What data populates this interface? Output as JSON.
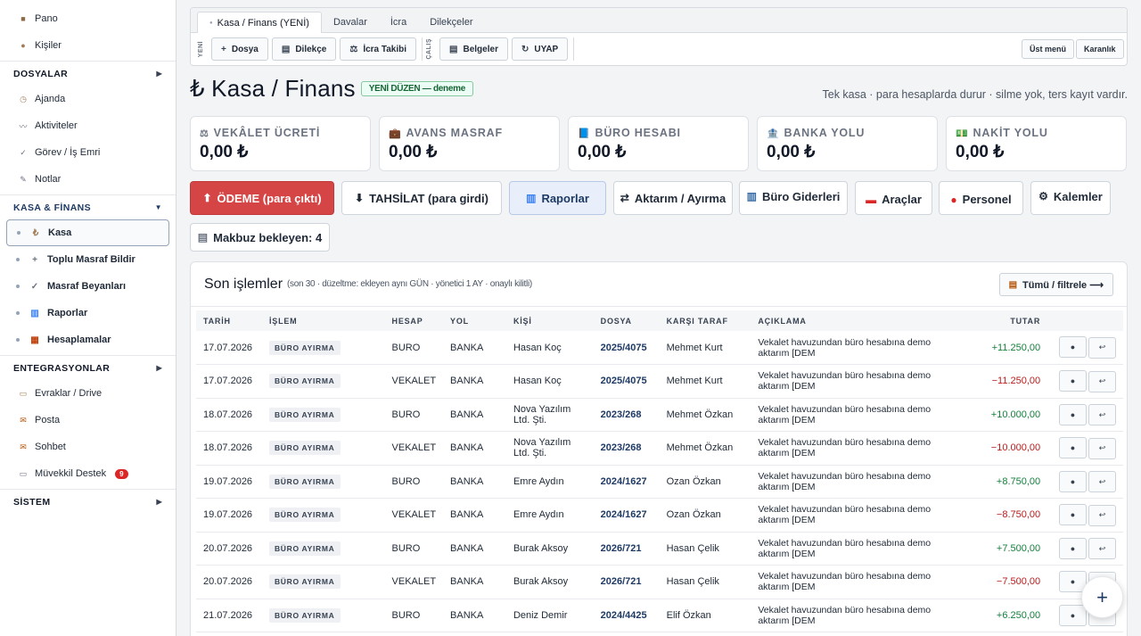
{
  "sidebar": {
    "top_items": [
      {
        "label": "Pano",
        "icon": "square-icon"
      },
      {
        "label": "Kişiler",
        "icon": "circle-icon"
      }
    ],
    "sec_dosyalar": "DOSYALAR",
    "dos_items": [
      {
        "label": "Ajanda",
        "icon": "clock-icon"
      },
      {
        "label": "Aktiviteler",
        "icon": "activity-icon"
      },
      {
        "label": "Görev / İş Emri",
        "icon": "check-icon"
      },
      {
        "label": "Notlar",
        "icon": "pencil-icon"
      }
    ],
    "sec_kasa": "KASA & FİNANS",
    "kasa_items": [
      {
        "label": "Kasa",
        "icon": "₺"
      },
      {
        "label": "Toplu Masraf Bildir",
        "icon": "+"
      },
      {
        "label": "Masraf Beyanları",
        "icon": "✓"
      },
      {
        "label": "Raporlar",
        "icon": "chart-icon"
      },
      {
        "label": "Hesaplamalar",
        "icon": "calculator-icon"
      }
    ],
    "sec_entegrasyon": "ENTEGRASYONLAR",
    "ent_items": [
      {
        "label": "Evraklar / Drive",
        "icon": "folder-icon"
      },
      {
        "label": "Posta",
        "icon": "mail-icon"
      },
      {
        "label": "Sohbet",
        "icon": "mail-icon"
      },
      {
        "label": "Müvekkil Destek",
        "icon": "chat-icon",
        "badge": "9"
      }
    ],
    "sec_sistem": "SİSTEM"
  },
  "topbar": {
    "tabs": [
      "Kasa / Finans (YENİ)",
      "Davalar",
      "İcra",
      "Dilekçeler"
    ],
    "vlabel_yeni": "YENİ",
    "vlabel_calis": "ÇALIŞ",
    "btn_dosya": "Dosya",
    "btn_dilekce": "Dilekçe",
    "btn_icra": "İcra Takibi",
    "btn_belgeler": "Belgeler",
    "btn_uyap": "UYAP",
    "btn_ust_menu": "Üst menü",
    "btn_karanlik": "Karanlık"
  },
  "header": {
    "title": "₺ Kasa / Finans",
    "tag": "YENİ DÜZEN — deneme",
    "subtitle": "Tek kasa · para hesaplarda durur · silme yok, ters kayıt vardır."
  },
  "cards": [
    {
      "label": "VEKÂLET ÜCRETİ",
      "value": "0,00 ₺",
      "icon": "⚖"
    },
    {
      "label": "AVANS MASRAF",
      "value": "0,00 ₺",
      "icon": "💼"
    },
    {
      "label": "BÜRO HESABI",
      "value": "0,00 ₺",
      "icon": "📘"
    },
    {
      "label": "BANKA YOLU",
      "value": "0,00 ₺",
      "icon": "🏦"
    },
    {
      "label": "NAKİT YOLU",
      "value": "0,00 ₺",
      "icon": "💵"
    }
  ],
  "actions": {
    "odeme": "ÖDEME (para çıktı)",
    "tahsilat": "TAHSİLAT (para girdi)",
    "raporlar": "Raporlar",
    "aktarim": "Aktarım / Ayırma",
    "buro_giderleri": "Büro Giderleri",
    "araclar": "Araçlar",
    "personel": "Personel",
    "kalemler": "Kalemler",
    "makbuz": "Makbuz bekleyen: 4"
  },
  "panel": {
    "title": "Son işlemler",
    "note": "(son 30 · düzeltme: ekleyen aynı GÜN · yönetici 1 AY · onaylı kilitli)",
    "filter_btn": "Tümü / filtrele ⟶"
  },
  "table": {
    "columns": [
      "TARİH",
      "İŞLEM",
      "HESAP",
      "YOL",
      "KİŞİ",
      "DOSYA",
      "KARŞI TARAF",
      "AÇIKLAMA",
      "TUTAR"
    ],
    "rows": [
      {
        "tarih": "17.07.2026",
        "islem": "BÜRO AYIRMA",
        "hesap": "BURO",
        "yol": "BANKA",
        "kisi": "Hasan Koç",
        "dosya": "2025/4075",
        "karsi": "Mehmet Kurt",
        "aciklama": "Vekalet havuzundan büro hesabına demo aktarım [DEM",
        "tutar": "+11.250,00"
      },
      {
        "tarih": "17.07.2026",
        "islem": "BÜRO AYIRMA",
        "hesap": "VEKALET",
        "yol": "BANKA",
        "kisi": "Hasan Koç",
        "dosya": "2025/4075",
        "karsi": "Mehmet Kurt",
        "aciklama": "Vekalet havuzundan büro hesabına demo aktarım [DEM",
        "tutar": "−11.250,00"
      },
      {
        "tarih": "18.07.2026",
        "islem": "BÜRO AYIRMA",
        "hesap": "BURO",
        "yol": "BANKA",
        "kisi": "Nova Yazılım Ltd. Şti.",
        "dosya": "2023/268",
        "karsi": "Mehmet Özkan",
        "aciklama": "Vekalet havuzundan büro hesabına demo aktarım [DEM",
        "tutar": "+10.000,00"
      },
      {
        "tarih": "18.07.2026",
        "islem": "BÜRO AYIRMA",
        "hesap": "VEKALET",
        "yol": "BANKA",
        "kisi": "Nova Yazılım Ltd. Şti.",
        "dosya": "2023/268",
        "karsi": "Mehmet Özkan",
        "aciklama": "Vekalet havuzundan büro hesabına demo aktarım [DEM",
        "tutar": "−10.000,00"
      },
      {
        "tarih": "19.07.2026",
        "islem": "BÜRO AYIRMA",
        "hesap": "BURO",
        "yol": "BANKA",
        "kisi": "Emre Aydın",
        "dosya": "2024/1627",
        "karsi": "Ozan Özkan",
        "aciklama": "Vekalet havuzundan büro hesabına demo aktarım [DEM",
        "tutar": "+8.750,00"
      },
      {
        "tarih": "19.07.2026",
        "islem": "BÜRO AYIRMA",
        "hesap": "VEKALET",
        "yol": "BANKA",
        "kisi": "Emre Aydın",
        "dosya": "2024/1627",
        "karsi": "Ozan Özkan",
        "aciklama": "Vekalet havuzundan büro hesabına demo aktarım [DEM",
        "tutar": "−8.750,00"
      },
      {
        "tarih": "20.07.2026",
        "islem": "BÜRO AYIRMA",
        "hesap": "BURO",
        "yol": "BANKA",
        "kisi": "Burak Aksoy",
        "dosya": "2026/721",
        "karsi": "Hasan Çelik",
        "aciklama": "Vekalet havuzundan büro hesabına demo aktarım [DEM",
        "tutar": "+7.500,00"
      },
      {
        "tarih": "20.07.2026",
        "islem": "BÜRO AYIRMA",
        "hesap": "VEKALET",
        "yol": "BANKA",
        "kisi": "Burak Aksoy",
        "dosya": "2026/721",
        "karsi": "Hasan Çelik",
        "aciklama": "Vekalet havuzundan büro hesabına demo aktarım [DEM",
        "tutar": "−7.500,00"
      },
      {
        "tarih": "21.07.2026",
        "islem": "BÜRO AYIRMA",
        "hesap": "BURO",
        "yol": "BANKA",
        "kisi": "Deniz Demir",
        "dosya": "2024/4425",
        "karsi": "Elif Özkan",
        "aciklama": "Vekalet havuzundan büro hesabına demo aktarım [DEM",
        "tutar": "+6.250,00"
      }
    ]
  },
  "fab_label": "+"
}
